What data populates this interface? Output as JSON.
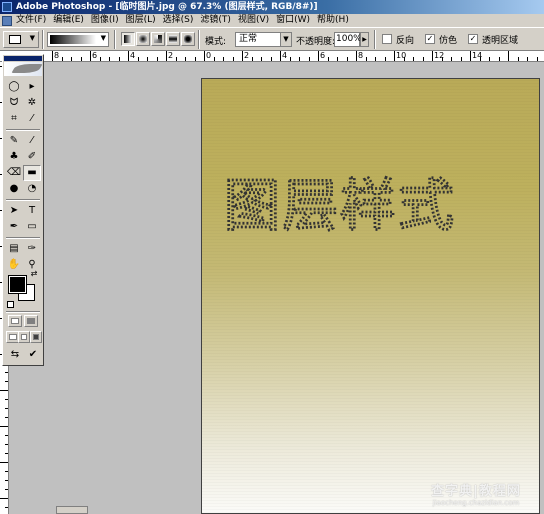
{
  "title_bar": {
    "text": "Adobe Photoshop - [临时图片.jpg @ 67.3% (图层样式, RGB/8#)]"
  },
  "menu": [
    "文件(F)",
    "编辑(E)",
    "图像(I)",
    "图层(L)",
    "选择(S)",
    "滤镜(T)",
    "视图(V)",
    "窗口(W)",
    "帮助(H)"
  ],
  "options": {
    "mode_label": "模式:",
    "mode_value": "正常",
    "opacity_label": "不透明度:",
    "opacity_value": "100%",
    "reverse_label": "反向",
    "reverse_checked": false,
    "dither_label": "仿色",
    "dither_checked": true,
    "transparency_label": "透明区域",
    "transparency_checked": true
  },
  "ruler": {
    "h_labels": [
      "8",
      "6",
      "4",
      "2",
      "0",
      "2",
      "4",
      "6",
      "8",
      "10",
      "12",
      "14"
    ],
    "v_labels": [
      "2",
      "0",
      "2",
      "4",
      "6",
      "8",
      "10",
      "12",
      "14",
      "16",
      "18",
      "20"
    ]
  },
  "canvas": {
    "selection_text": "图层样式",
    "gradient_top_color": "#b9aa58",
    "gradient_bottom_color": "#fbfbf8"
  },
  "colors": {
    "foreground": "#000000",
    "background": "#ffffff"
  },
  "watermark": {
    "line1": "查字典|教程网",
    "line2": "jiaocheng.chazidian.com"
  }
}
